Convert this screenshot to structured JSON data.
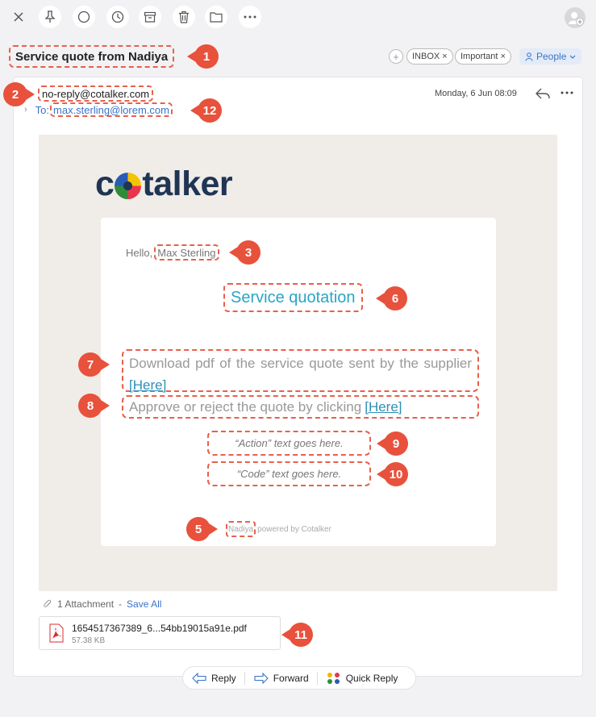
{
  "toolbar": {
    "icons": [
      "close-icon",
      "pin-icon",
      "circle-icon",
      "clock-icon",
      "archive-icon",
      "trash-icon",
      "folder-icon",
      "more-icon",
      "add-person-icon"
    ]
  },
  "subject": "Service quote from Nadiya",
  "tags": [
    {
      "label": "INBOX",
      "remove": "×"
    },
    {
      "label": "Important",
      "remove": "×"
    }
  ],
  "tag_add": "+",
  "people_label": "People",
  "message": {
    "from": "no-reply@cotalker.com",
    "to_label": "To:",
    "to": "max.sterling@lorem.com",
    "date": "Monday, 6 Jun 08:09"
  },
  "email": {
    "logo_prefix": "c",
    "logo_suffix": "talker",
    "hello": "Hello,",
    "name": "Max Sterling",
    "title": "Service quotation",
    "download_text": "Download pdf of the service quote sent by the supplier",
    "approve_text": "Approve or reject the quote by clicking",
    "link_text": "[Here]",
    "action_text": "“Action” text goes here.",
    "code_text": "“Code” text goes here.",
    "footer_name": "Nadiya",
    "footer_text": "powered by Cotalker"
  },
  "attachment": {
    "count_label": "1 Attachment",
    "separator": "-",
    "save_all": "Save All",
    "file_name": "1654517367389_6...54bb19015a91e.pdf",
    "file_size": "57.38 KB"
  },
  "actions": {
    "reply": "Reply",
    "forward": "Forward",
    "quick_reply": "Quick Reply"
  },
  "markers": [
    "1",
    "2",
    "3",
    "5",
    "6",
    "7",
    "8",
    "9",
    "10",
    "11",
    "12"
  ],
  "colors": {
    "marker": "#e8513c",
    "link": "#3a73c9",
    "accent_teal": "#2aa5c4"
  }
}
